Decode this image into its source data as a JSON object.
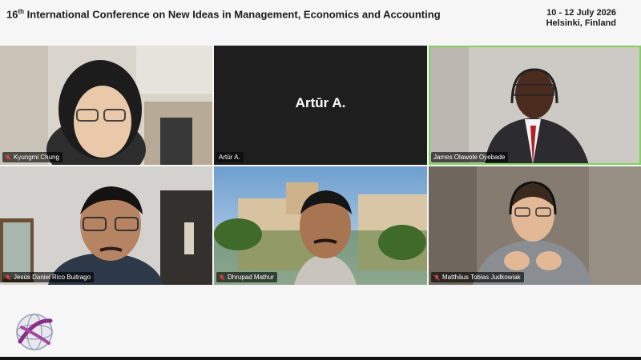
{
  "header": {
    "title_num": "16",
    "title_sup": "th",
    "title_rest": " International Conference on New Ideas in Management, Economics and Accounting",
    "date": "10 - 12 July 2026",
    "location": "Helsinki, Finland"
  },
  "participants": [
    {
      "name": "Kyungmi Chung",
      "muted": true
    },
    {
      "name": "Artūr A.",
      "muted": false,
      "center_label": "Artūr A."
    },
    {
      "name": "James Olawole Oyebade",
      "muted": false,
      "active": true
    },
    {
      "name": "Jesús Daniel Rico Buitrago",
      "muted": true
    },
    {
      "name": "Dhrupad Mathur",
      "muted": true
    },
    {
      "name": "Matthäus Tobias Judkowiak",
      "muted": true
    }
  ],
  "colors": {
    "active_speaker_border": "#7fd35a",
    "mute_icon": "#e0453a"
  }
}
